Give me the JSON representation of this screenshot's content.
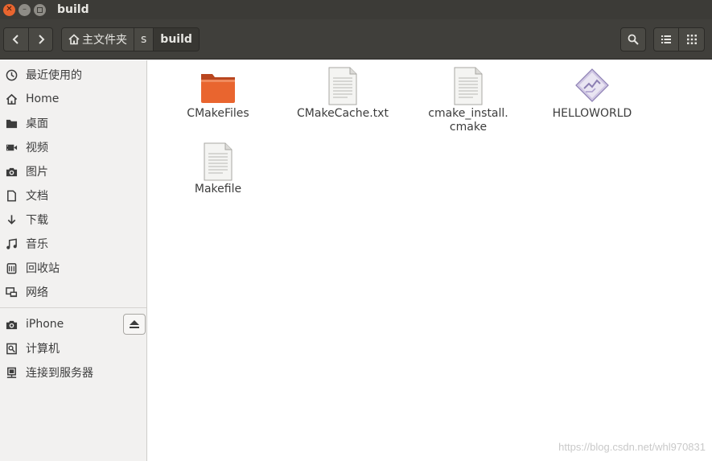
{
  "window": {
    "title": "build"
  },
  "headerbar": {
    "path": [
      {
        "label": "主文件夹",
        "icon": "home-icon"
      },
      {
        "label": "s"
      },
      {
        "label": "build",
        "current": true
      }
    ]
  },
  "sidebar": {
    "places": [
      {
        "label": "最近使用的",
        "icon": "recent-icon"
      },
      {
        "label": "Home",
        "icon": "home-icon"
      },
      {
        "label": "桌面",
        "icon": "desktop-folder-icon"
      },
      {
        "label": "视频",
        "icon": "video-icon"
      },
      {
        "label": "图片",
        "icon": "camera-icon"
      },
      {
        "label": "文档",
        "icon": "document-icon"
      },
      {
        "label": "下载",
        "icon": "download-icon"
      },
      {
        "label": "音乐",
        "icon": "music-icon"
      },
      {
        "label": "回收站",
        "icon": "trash-icon"
      },
      {
        "label": "网络",
        "icon": "network-icon"
      }
    ],
    "devices": [
      {
        "label": "iPhone",
        "icon": "camera-icon"
      },
      {
        "label": "计算机",
        "icon": "computer-icon"
      },
      {
        "label": "连接到服务器",
        "icon": "server-icon"
      }
    ]
  },
  "files": [
    {
      "name": "CMakeFiles",
      "type": "folder"
    },
    {
      "name": "CMakeCache.txt",
      "type": "text"
    },
    {
      "name": "cmake_install.\ncmake",
      "type": "text"
    },
    {
      "name": "HELLOWORLD",
      "type": "executable"
    },
    {
      "name": "Makefile",
      "type": "text"
    }
  ],
  "watermark": "https://blog.csdn.net/whl970831",
  "colors": {
    "titlebar": "#3c3b37",
    "headerbar": "#403f3b",
    "close_button": "#e9652f",
    "folder_orange": "#e9652f",
    "sidebar_bg": "#f2f1f0"
  }
}
